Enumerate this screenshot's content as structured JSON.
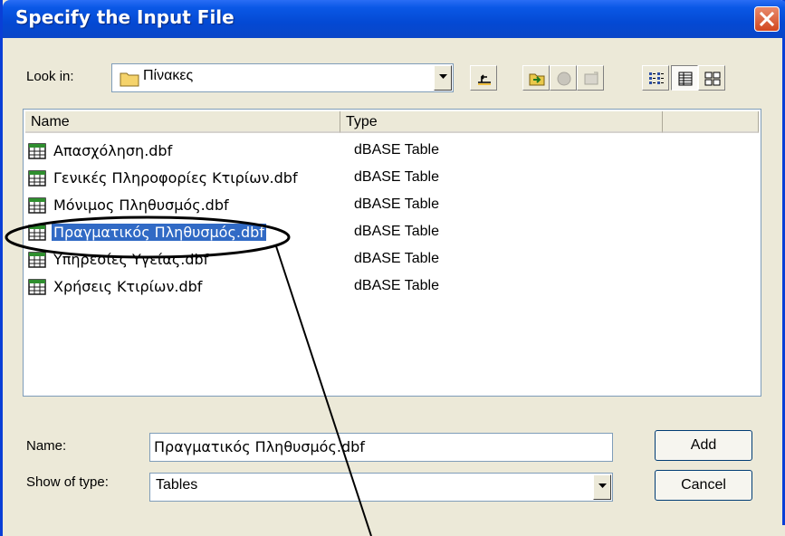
{
  "dialog": {
    "title": "Specify the Input File"
  },
  "look_in": {
    "label": "Look in:",
    "value": "Πίνακες"
  },
  "toolbar": {
    "icons": [
      "up-one-level-icon",
      "connect-folder-icon",
      "disconnect-folder-icon",
      "properties-icon",
      "list-view-icon",
      "details-view-icon",
      "thumbnails-view-icon"
    ]
  },
  "file_list": {
    "columns": [
      "Name",
      "Type"
    ],
    "rows": [
      {
        "name": "Απασχόληση.dbf",
        "type": "dBASE Table"
      },
      {
        "name": "Γενικές Πληροφορίες Κτιρίων.dbf",
        "type": "dBASE Table"
      },
      {
        "name": "Μόνιμος Πληθυσμός.dbf",
        "type": "dBASE Table"
      },
      {
        "name": "Πραγματικός Πληθυσμός.dbf",
        "type": "dBASE Table"
      },
      {
        "name": "Υπηρεσίες Υγείας.dbf",
        "type": "dBASE Table"
      },
      {
        "name": "Χρήσεις Κτιρίων.dbf",
        "type": "dBASE Table"
      }
    ],
    "selected_index": 3
  },
  "name_field": {
    "label": "Name:",
    "value": "Πραγματικός Πληθυσμός.dbf"
  },
  "type_field": {
    "label": "Show of type:",
    "value": "Tables"
  },
  "buttons": {
    "add": "Add",
    "cancel": "Cancel"
  },
  "colors": {
    "titlebar": "#0a58e6",
    "selection": "#316ac5",
    "close_button": "#d2471f",
    "annotation": "#000000"
  }
}
